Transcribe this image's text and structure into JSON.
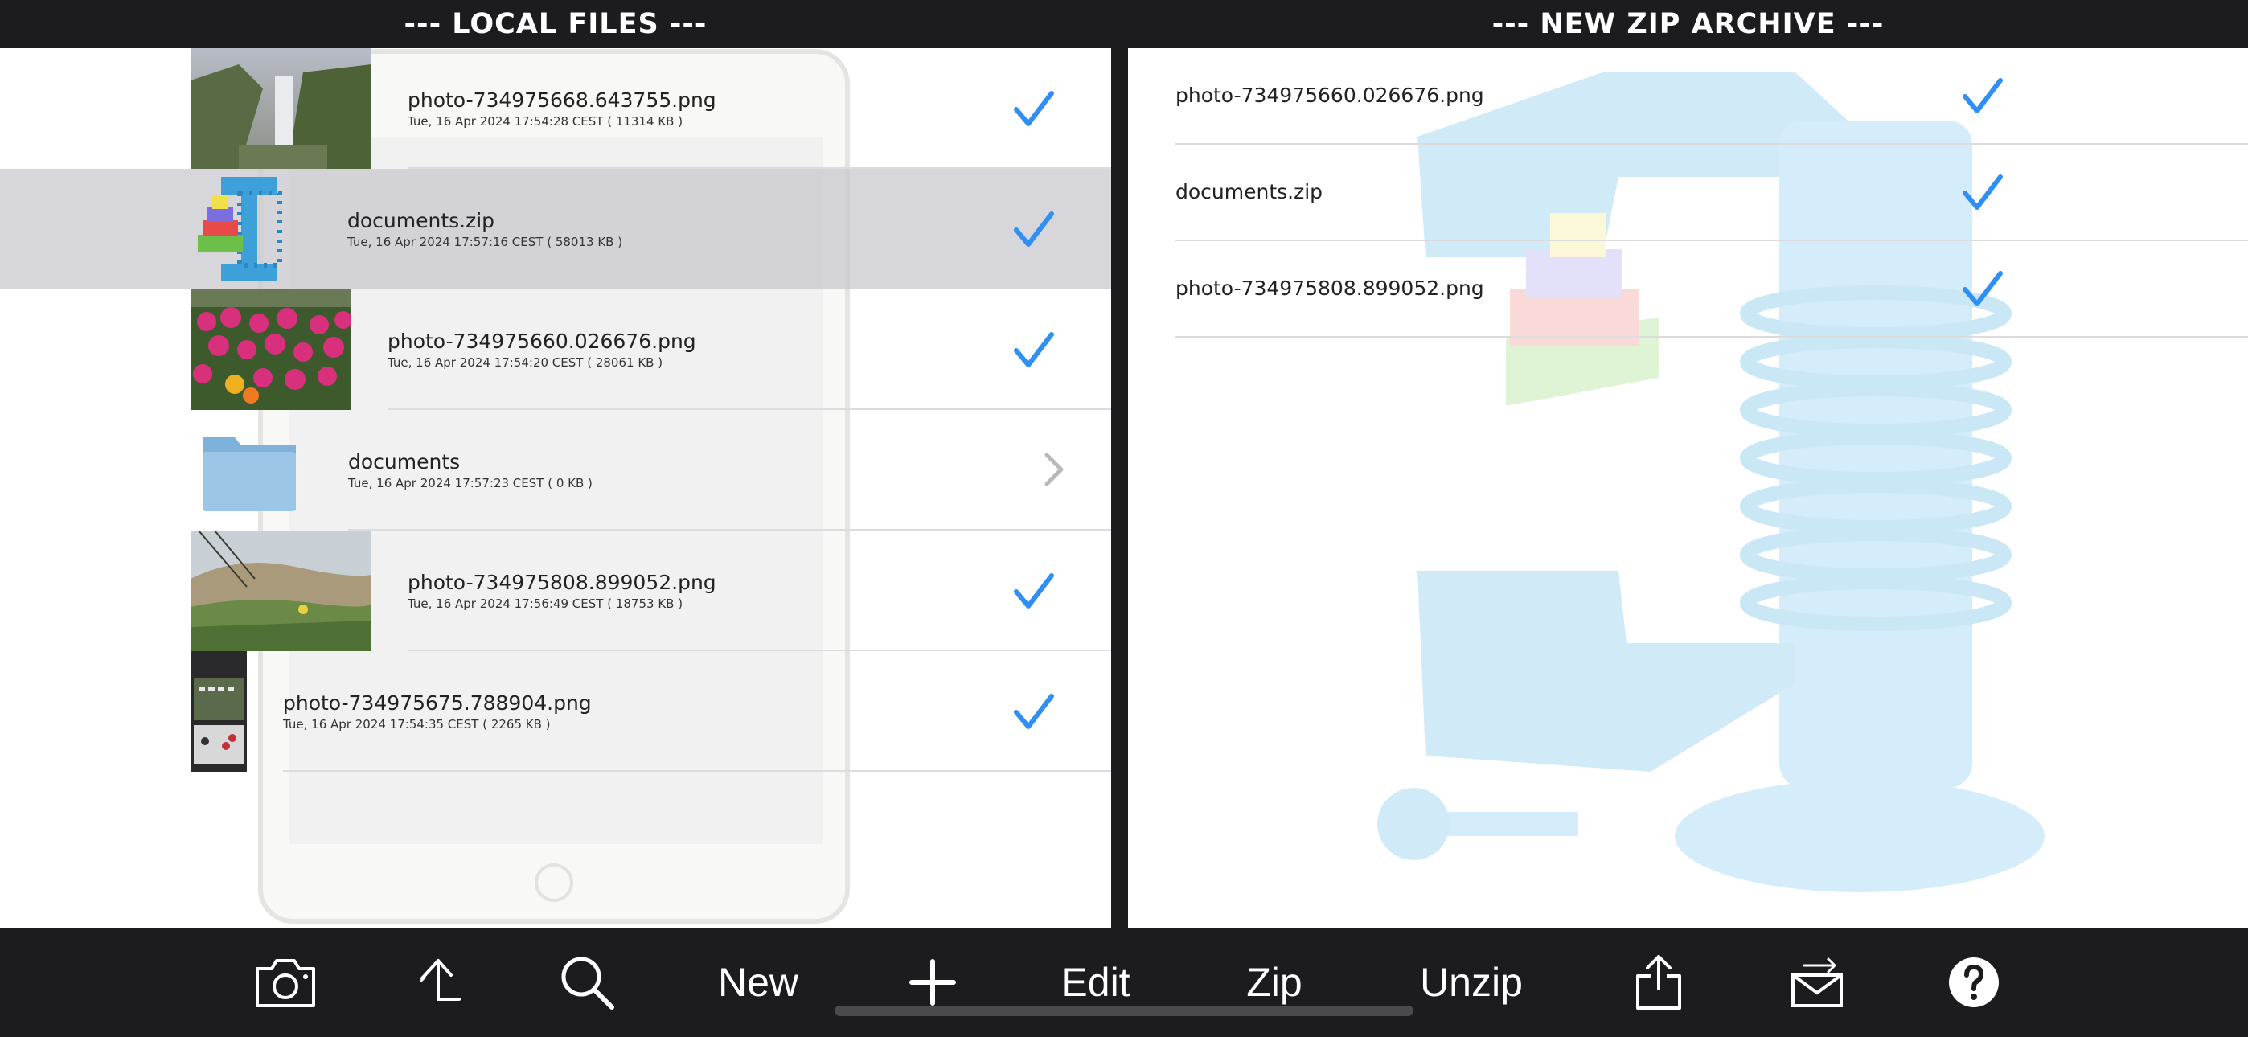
{
  "headers": {
    "left": "--- LOCAL FILES ---",
    "right": "--- NEW ZIP ARCHIVE ---"
  },
  "local_files": [
    {
      "name": "photo-734975668.643755.png",
      "meta": "Tue, 16 Apr 2024 17:54:28 CEST ( 11314 KB )",
      "thumb": "waterfall-photo",
      "state": "checked",
      "selected": false
    },
    {
      "name": "documents.zip",
      "meta": "Tue, 16 Apr 2024 17:57:16 CEST ( 58013 KB )",
      "thumb": "zip-archive-icon",
      "state": "checked",
      "selected": true
    },
    {
      "name": "photo-734975660.026676.png",
      "meta": "Tue, 16 Apr 2024 17:54:20 CEST ( 28061 KB )",
      "thumb": "flowers-photo",
      "state": "checked",
      "selected": false
    },
    {
      "name": "documents",
      "meta": "Tue, 16 Apr 2024 17:57:23 CEST ( 0 KB )",
      "thumb": "folder-icon",
      "state": "folder",
      "selected": false
    },
    {
      "name": "photo-734975808.899052.png",
      "meta": "Tue, 16 Apr 2024 17:56:49 CEST ( 18753 KB )",
      "thumb": "dunes-photo",
      "state": "checked",
      "selected": false
    },
    {
      "name": "photo-734975675.788904.png",
      "meta": "Tue, 16 Apr 2024 17:54:35 CEST ( 2265 KB )",
      "thumb": "game-screenshot",
      "state": "checked",
      "selected": false
    }
  ],
  "archive_files": [
    {
      "name": "photo-734975660.026676.png",
      "state": "checked"
    },
    {
      "name": "documents.zip",
      "state": "checked"
    },
    {
      "name": "photo-734975808.899052.png",
      "state": "checked"
    }
  ],
  "toolbar": {
    "camera": "camera-icon",
    "up": "up-folder-icon",
    "search": "search-icon",
    "new_label": "New",
    "add": "plus-icon",
    "edit_label": "Edit",
    "zip_label": "Zip",
    "unzip_label": "Unzip",
    "share": "share-icon",
    "mail": "mail-icon",
    "help": "help-icon"
  },
  "colors": {
    "accent": "#2f8ff5",
    "bar": "#1c1c1e",
    "selected_row": "#d0d0d4"
  }
}
